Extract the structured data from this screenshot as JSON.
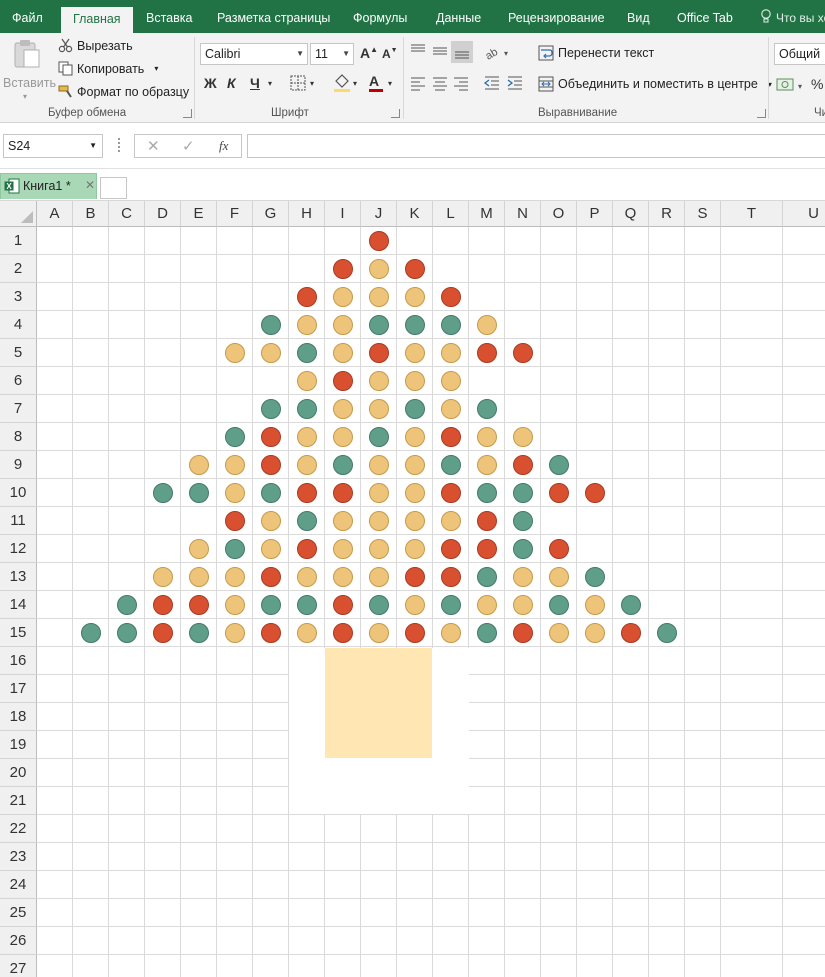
{
  "menu": {
    "tabs": [
      "Файл",
      "Главная",
      "Вставка",
      "Разметка страницы",
      "Формулы",
      "Данные",
      "Рецензирование",
      "Вид",
      "Office Tab"
    ],
    "active_tab": "Главная",
    "tell_me": "Что вы хо"
  },
  "ribbon": {
    "clipboard": {
      "paste": "Вставить",
      "cut": "Вырезать",
      "copy": "Копировать",
      "format_painter": "Формат по образцу",
      "label": "Буфер обмена"
    },
    "font": {
      "family": "Calibri",
      "size": "11",
      "bold": "Ж",
      "italic": "К",
      "underline": "Ч",
      "grow": "A",
      "shrink": "A",
      "color_letter": "A",
      "label": "Шрифт"
    },
    "alignment": {
      "wrap_text": "Перенести текст",
      "merge_center": "Объединить и поместить в центре",
      "label": "Выравнивание"
    },
    "number": {
      "format": "Общий",
      "percent": "%",
      "label": "Чи"
    }
  },
  "formula_bar": {
    "name_box": "S24",
    "fx": "fx",
    "formula": ""
  },
  "workbook_tab": {
    "name": "Книга1 *",
    "close": "✕"
  },
  "sheet": {
    "columns": [
      "A",
      "B",
      "C",
      "D",
      "E",
      "F",
      "G",
      "H",
      "I",
      "J",
      "K",
      "L",
      "M",
      "N",
      "O",
      "P",
      "Q",
      "R",
      "S",
      "T",
      "U"
    ],
    "rows": [
      "1",
      "2",
      "3",
      "4",
      "5",
      "6",
      "7",
      "8",
      "9",
      "10",
      "11",
      "12",
      "13",
      "14",
      "15",
      "16",
      "17",
      "18",
      "19",
      "20",
      "21",
      "22",
      "23",
      "24",
      "25",
      "26",
      "27"
    ],
    "ball_colors": {
      "r": "#d95030",
      "y": "#edc47a",
      "g": "#5f9e88"
    },
    "trunk_color": "#ffe6b3",
    "tree_rows": [
      {
        "row": "1",
        "start": "J",
        "pattern": "r"
      },
      {
        "row": "2",
        "start": "I",
        "pattern": "ryr"
      },
      {
        "row": "3",
        "start": "H",
        "pattern": "ryyyr"
      },
      {
        "row": "4",
        "start": "G",
        "pattern": "gyygggy"
      },
      {
        "row": "5",
        "start": "F",
        "pattern": "yygyryyrr"
      },
      {
        "row": "6",
        "start": "H",
        "pattern": "yryyy"
      },
      {
        "row": "7",
        "start": "G",
        "pattern": "ggyygyg"
      },
      {
        "row": "8",
        "start": "F",
        "pattern": "gryygyryy"
      },
      {
        "row": "9",
        "start": "E",
        "pattern": "yyrygyygyrg"
      },
      {
        "row": "10",
        "start": "D",
        "pattern": "ggygrryyrggrr"
      },
      {
        "row": "11",
        "start": "F",
        "pattern": "rygyyyyrg"
      },
      {
        "row": "12",
        "start": "E",
        "pattern": "ygyryyyrrgr"
      },
      {
        "row": "13",
        "start": "D",
        "pattern": "yyyryyyrrgyyg"
      },
      {
        "row": "14",
        "start": "C",
        "pattern": "grryggrgygyygyg"
      },
      {
        "row": "15",
        "start": "B",
        "pattern": "ggrgyryryrygryyrg"
      }
    ]
  }
}
